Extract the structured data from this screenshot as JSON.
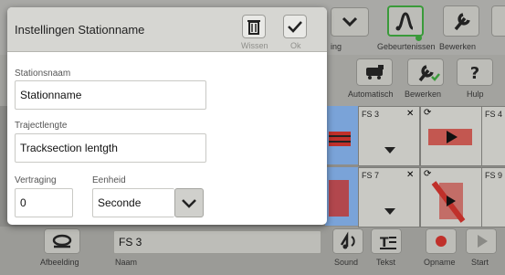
{
  "dialog": {
    "title": "Instellingen Stationname",
    "delete_label": "Wissen",
    "ok_label": "Ok",
    "station_name_label": "Stationsnaam",
    "station_name_value": "Stationname",
    "track_length_label": "Trajectlengte",
    "track_length_value": "Tracksection lentgth",
    "delay_label": "Vertraging",
    "delay_value": "0",
    "unit_label": "Eenheid",
    "unit_value": "Seconde"
  },
  "toolbar_top": {
    "item1_label": "ing",
    "events_label": "Gebeurtenissen",
    "edit_label": "Bewerken"
  },
  "toolbar_second": {
    "automatic_label": "Automatisch",
    "edit_label": "Bewerken",
    "help_label": "Hulp"
  },
  "grid": {
    "cells": [
      {
        "label": "FS 3"
      },
      {
        "label": "FS 4"
      },
      {
        "label": "FS 7"
      },
      {
        "label": "FS 9"
      }
    ]
  },
  "bottom_bar": {
    "image_label": "Afbeelding",
    "name_value": "FS 3",
    "name_label": "Naam",
    "sound_label": "Sound",
    "text_label": "Tekst",
    "record_label": "Opname",
    "start_label": "Start"
  },
  "colors": {
    "status_green": "#3a9a3a",
    "record_red": "#c0302a",
    "selection_blue": "#7aa3d8"
  },
  "icons": [
    "trash-icon",
    "check-icon",
    "chevron-down-icon",
    "wrench-icon",
    "help-icon",
    "train-icon",
    "sound-icon",
    "text-icon",
    "record-icon",
    "play-icon",
    "close-icon"
  ]
}
